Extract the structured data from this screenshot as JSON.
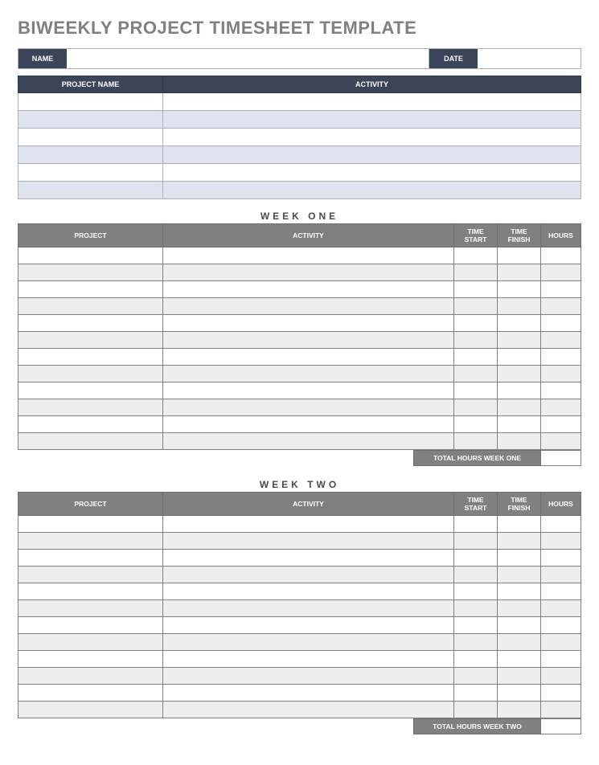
{
  "title": "BIWEEKLY PROJECT TIMESHEET TEMPLATE",
  "header": {
    "name_label": "NAME",
    "name_value": "",
    "date_label": "DATE",
    "date_value": ""
  },
  "top_table": {
    "headers": {
      "project": "PROJECT NAME",
      "activity": "ACTIVITY"
    },
    "rows": [
      {
        "project": "",
        "activity": ""
      },
      {
        "project": "",
        "activity": ""
      },
      {
        "project": "",
        "activity": ""
      },
      {
        "project": "",
        "activity": ""
      },
      {
        "project": "",
        "activity": ""
      },
      {
        "project": "",
        "activity": ""
      }
    ]
  },
  "week_headers": {
    "project": "PROJECT",
    "activity": "ACTIVITY",
    "time_start": "TIME START",
    "time_finish": "TIME FINISH",
    "hours": "HOURS"
  },
  "week_one": {
    "title": "WEEK ONE",
    "rows": [
      {
        "project": "",
        "activity": "",
        "time_start": "",
        "time_finish": "",
        "hours": ""
      },
      {
        "project": "",
        "activity": "",
        "time_start": "",
        "time_finish": "",
        "hours": ""
      },
      {
        "project": "",
        "activity": "",
        "time_start": "",
        "time_finish": "",
        "hours": ""
      },
      {
        "project": "",
        "activity": "",
        "time_start": "",
        "time_finish": "",
        "hours": ""
      },
      {
        "project": "",
        "activity": "",
        "time_start": "",
        "time_finish": "",
        "hours": ""
      },
      {
        "project": "",
        "activity": "",
        "time_start": "",
        "time_finish": "",
        "hours": ""
      },
      {
        "project": "",
        "activity": "",
        "time_start": "",
        "time_finish": "",
        "hours": ""
      },
      {
        "project": "",
        "activity": "",
        "time_start": "",
        "time_finish": "",
        "hours": ""
      },
      {
        "project": "",
        "activity": "",
        "time_start": "",
        "time_finish": "",
        "hours": ""
      },
      {
        "project": "",
        "activity": "",
        "time_start": "",
        "time_finish": "",
        "hours": ""
      },
      {
        "project": "",
        "activity": "",
        "time_start": "",
        "time_finish": "",
        "hours": ""
      },
      {
        "project": "",
        "activity": "",
        "time_start": "",
        "time_finish": "",
        "hours": ""
      }
    ],
    "total_label": "TOTAL HOURS WEEK ONE",
    "total_value": ""
  },
  "week_two": {
    "title": "WEEK TWO",
    "rows": [
      {
        "project": "",
        "activity": "",
        "time_start": "",
        "time_finish": "",
        "hours": ""
      },
      {
        "project": "",
        "activity": "",
        "time_start": "",
        "time_finish": "",
        "hours": ""
      },
      {
        "project": "",
        "activity": "",
        "time_start": "",
        "time_finish": "",
        "hours": ""
      },
      {
        "project": "",
        "activity": "",
        "time_start": "",
        "time_finish": "",
        "hours": ""
      },
      {
        "project": "",
        "activity": "",
        "time_start": "",
        "time_finish": "",
        "hours": ""
      },
      {
        "project": "",
        "activity": "",
        "time_start": "",
        "time_finish": "",
        "hours": ""
      },
      {
        "project": "",
        "activity": "",
        "time_start": "",
        "time_finish": "",
        "hours": ""
      },
      {
        "project": "",
        "activity": "",
        "time_start": "",
        "time_finish": "",
        "hours": ""
      },
      {
        "project": "",
        "activity": "",
        "time_start": "",
        "time_finish": "",
        "hours": ""
      },
      {
        "project": "",
        "activity": "",
        "time_start": "",
        "time_finish": "",
        "hours": ""
      },
      {
        "project": "",
        "activity": "",
        "time_start": "",
        "time_finish": "",
        "hours": ""
      },
      {
        "project": "",
        "activity": "",
        "time_start": "",
        "time_finish": "",
        "hours": ""
      }
    ],
    "total_label": "TOTAL HOURS WEEK TWO",
    "total_value": ""
  }
}
